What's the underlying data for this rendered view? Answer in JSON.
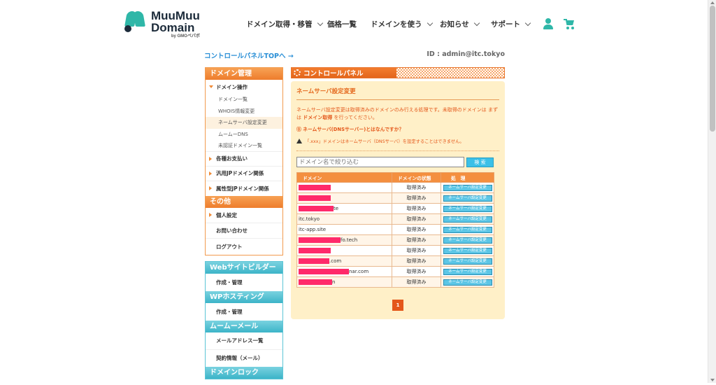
{
  "brand": {
    "line1": "MuuMuu",
    "line2": "Domain",
    "sub": "by GMOペパボ"
  },
  "nav": [
    {
      "label": "ドメイン取得・移管",
      "has_menu": true
    },
    {
      "label": "価格一覧",
      "has_menu": false
    },
    {
      "label": "ドメインを使う",
      "has_menu": true
    },
    {
      "label": "お知らせ",
      "has_menu": true
    },
    {
      "label": "サポート",
      "has_menu": true
    }
  ],
  "cp_link": "コントロールパネルTOPへ →",
  "user_id": "ID : admin@itc.tokyo",
  "sidebar": {
    "domain_mgmt": {
      "header": "ドメイン管理",
      "op": "ドメイン操作",
      "subs": [
        "ドメイン一覧",
        "WHOIS情報変更",
        "ネームサーバ設定変更",
        "ムームーDNS",
        "未認証ドメイン一覧"
      ],
      "items": [
        "各種お支払い",
        "汎用JPドメイン関係",
        "属性型JPドメイン関係"
      ]
    },
    "other": {
      "header": "その他",
      "items": [
        "個人設定",
        "お問い合わせ",
        "ログアウト"
      ]
    },
    "web_builder": {
      "header": "Webサイトビルダー",
      "item": "作成・管理"
    },
    "wp_hosting": {
      "header": "WPホスティング",
      "item": "作成・管理"
    },
    "mail": {
      "header": "ムームーメール",
      "items": [
        "メールアドレス一覧",
        "契約情報（メール）"
      ]
    },
    "domain_lock": {
      "header": "ドメインロック"
    }
  },
  "panel": {
    "header": "コントロールパネル",
    "title": "ネームサーバ設定変更",
    "desc_a": "ネームサーバ設定変更は取得済みのドメインのみ行える処理です。未取得のドメインは まずは ",
    "desc_link": "ドメイン取得",
    "desc_b": " を行ってください。",
    "help": "⓪ ネームサーバ(DNSサーバー)とはなんですか？",
    "warn": "「.xxx」ドメインはネームサーバ（DNSサーバ）を設定することはできません。",
    "search_placeholder": "ドメイン名で絞り込む",
    "search_button": "検 索",
    "columns": [
      "ドメイン",
      "ドメインの状態",
      "処　理"
    ],
    "action_label": "ネームサーバ設定変更",
    "rows": [
      {
        "suffix": "",
        "status": "取得済み"
      },
      {
        "suffix": "",
        "status": "取得済み"
      },
      {
        "suffix": "te",
        "status": "取得済み"
      },
      {
        "suffix": "itc.tokyo",
        "status": "取得済み"
      },
      {
        "suffix": "itc-app.site",
        "status": "取得済み"
      },
      {
        "suffix": "fo.tech",
        "status": "取得済み"
      },
      {
        "suffix": "",
        "status": "取得済み"
      },
      {
        "suffix": ".com",
        "status": "取得済み"
      },
      {
        "suffix": "nar.com",
        "status": "取得済み"
      },
      {
        "suffix": "n",
        "status": "取得済み"
      }
    ],
    "page": "1"
  }
}
